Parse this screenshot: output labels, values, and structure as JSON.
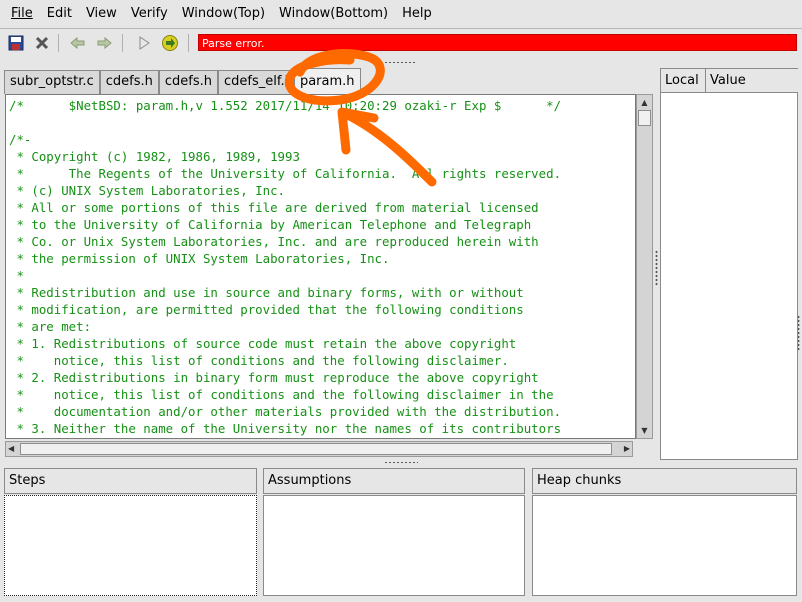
{
  "menu": {
    "file": "File",
    "edit": "Edit",
    "view": "View",
    "verify": "Verify",
    "window_top": "Window(Top)",
    "window_bottom": "Window(Bottom)",
    "help": "Help"
  },
  "toolbar": {
    "icons": [
      "save-icon",
      "close-icon",
      "back-icon",
      "forward-icon",
      "play-icon",
      "step-into-icon"
    ],
    "status_message": "Parse error.",
    "status_color": "#ff0000"
  },
  "tabs": [
    {
      "label": "subr_optstr.c"
    },
    {
      "label": "cdefs.h"
    },
    {
      "label": "cdefs.h"
    },
    {
      "label": "cdefs_elf.h"
    },
    {
      "label": "param.h"
    }
  ],
  "editor": {
    "text_color": "#169116",
    "lines": [
      "/*      $NetBSD: param.h,v 1.552 2017/11/14 10:20:29 ozaki-r Exp $      */",
      "",
      "/*-",
      " * Copyright (c) 1982, 1986, 1989, 1993",
      " *      The Regents of the University of California.  All rights reserved.",
      " * (c) UNIX System Laboratories, Inc.",
      " * All or some portions of this file are derived from material licensed",
      " * to the University of California by American Telephone and Telegraph",
      " * Co. or Unix System Laboratories, Inc. and are reproduced herein with",
      " * the permission of UNIX System Laboratories, Inc.",
      " *",
      " * Redistribution and use in source and binary forms, with or without",
      " * modification, are permitted provided that the following conditions",
      " * are met:",
      " * 1. Redistributions of source code must retain the above copyright",
      " *    notice, this list of conditions and the following disclaimer.",
      " * 2. Redistributions in binary form must reproduce the above copyright",
      " *    notice, this list of conditions and the following disclaimer in the",
      " *    documentation and/or other materials provided with the distribution.",
      " * 3. Neither the name of the University nor the names of its contributors"
    ]
  },
  "variables": {
    "col_local": "Local",
    "col_value": "Value"
  },
  "bottom": {
    "steps": "Steps",
    "assumptions": "Assumptions",
    "heap_chunks": "Heap chunks"
  },
  "annotation": {
    "color": "#ff6a00"
  }
}
